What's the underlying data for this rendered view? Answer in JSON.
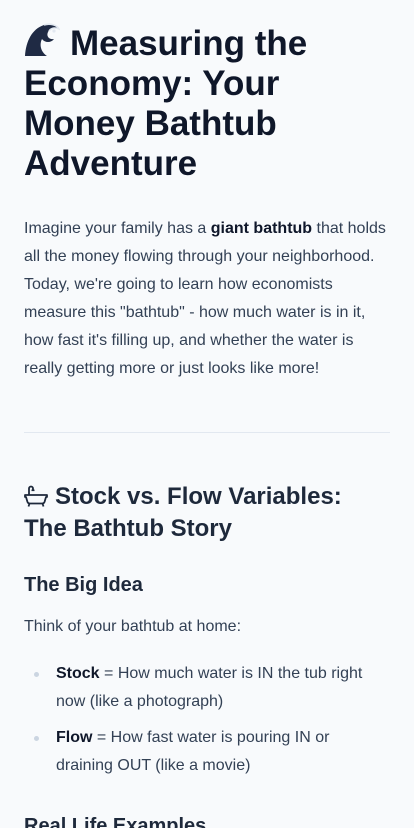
{
  "title": "Measuring the Economy: Your Money Bathtub Adventure",
  "title_icon": "wave-icon",
  "intro": {
    "before": "Imagine your family has a ",
    "strong": "giant bathtub",
    "after": " that holds all the money flowing through your neighborhood. Today, we're going to learn how economists measure this \"bathtub\" - how much water is in it, how fast it's filling up, and whether the water is really getting more or just looks like more!"
  },
  "section": {
    "icon": "bathtub-icon",
    "heading": "Stock vs. Flow Variables: The Bathtub Story",
    "subheading": "The Big Idea",
    "paragraph": "Think of your bathtub at home:",
    "bullets": [
      {
        "term": "Stock",
        "text": " = How much water is IN the tub right now (like a photograph)"
      },
      {
        "term": "Flow",
        "text": " = How fast water is pouring IN or draining OUT (like a movie)"
      }
    ],
    "next_subheading": "Real Life Examples"
  },
  "colors": {
    "background": "#f8fafc",
    "heading": "#0f172a",
    "body_text": "#334155",
    "divider": "#e2e8f0",
    "bullet": "#cbd5e1"
  }
}
